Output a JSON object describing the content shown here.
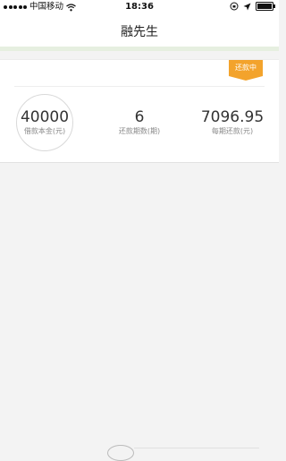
{
  "status_bar": {
    "carrier": "中国移动",
    "time": "18:36"
  },
  "header": {
    "title": "融先生"
  },
  "loan_card": {
    "status_badge": "还款中",
    "accent_color": "#f3a32c",
    "stats": [
      {
        "value": "40000",
        "label": "借款本金(元)"
      },
      {
        "value": "6",
        "label": "还款期数(期)"
      },
      {
        "value": "7096.95",
        "label": "每期还款(元)"
      }
    ]
  },
  "icons": [
    "signal-dots-icon",
    "wifi-icon",
    "lock-rotation-icon",
    "location-icon",
    "battery-icon"
  ]
}
